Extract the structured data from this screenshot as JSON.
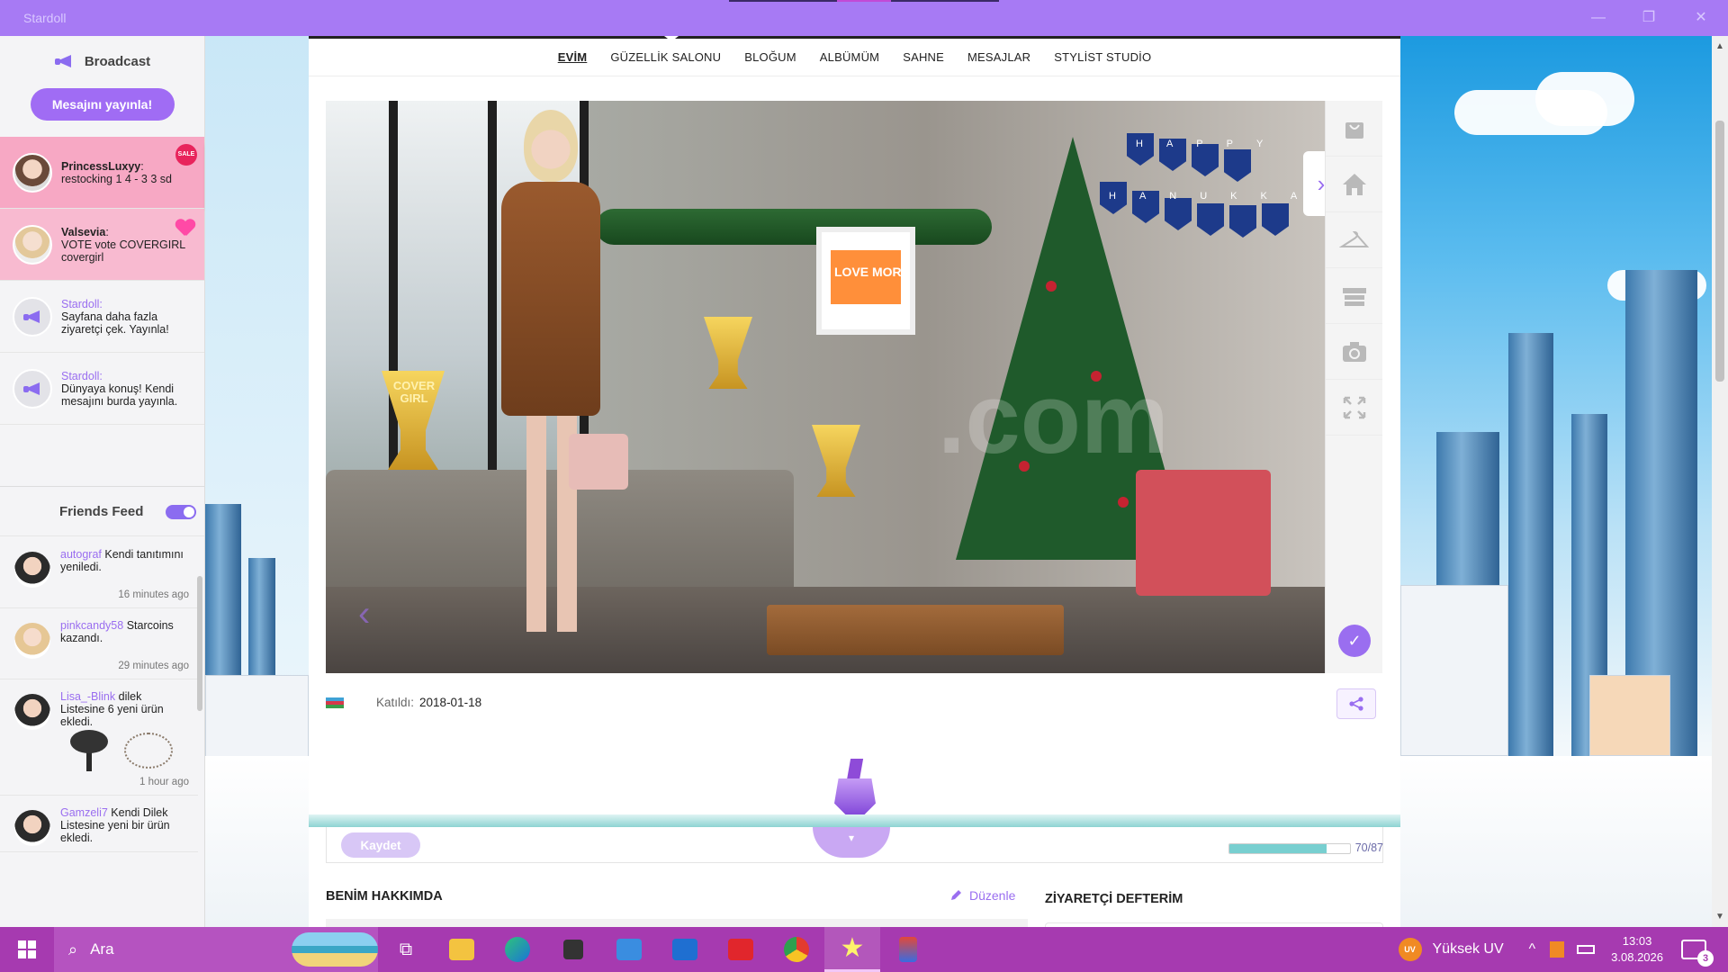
{
  "window": {
    "title": "Stardoll",
    "minimize_icon": "—",
    "restore_icon": "❐",
    "close_icon": "✕"
  },
  "sidebar": {
    "broadcast_title": "Broadcast",
    "publish_button": "Mesajını yayınla!",
    "collapse_icon": "‹",
    "broadcasts": [
      {
        "user": "PrincessLuxyy",
        "sep": ":",
        "message": "restocking 1 4 - 3 3 sd",
        "badge": "SALE"
      },
      {
        "user": "Valsevia",
        "sep": ":",
        "message": "VOTE vote COVERGIRL covergirl"
      },
      {
        "user": "Stardoll",
        "sep": ":",
        "message": "Sayfana daha fazla ziyaretçi çek. Yayınla!"
      },
      {
        "user": "Stardoll",
        "sep": ":",
        "message": "Dünyaya konuş! Kendi mesajını burda yayınla."
      }
    ],
    "friends_feed_title": "Friends Feed",
    "feed": [
      {
        "user": "autograf",
        "text": "Kendi tanıtımını yeniledi.",
        "time": "16 minutes ago"
      },
      {
        "user": "pinkcandy58",
        "text": "Starcoins kazandı.",
        "time": "29 minutes ago"
      },
      {
        "user": "Lisa_-Blink",
        "text": "dilek Listesine 6 yeni ürün ekledi.",
        "time": "1 hour ago"
      },
      {
        "user": "Gamzeli7",
        "text": "Kendi Dilek Listesine yeni bir ürün ekledi.",
        "time": ""
      }
    ]
  },
  "nav": {
    "tabs": [
      "EVİM",
      "GÜZELLİK SALONU",
      "BLOĞUM",
      "ALBÜMÜM",
      "SAHNE",
      "MESAJLAR",
      "STYLİST STUDİO"
    ],
    "active_index": 0
  },
  "room": {
    "trophy_text": "COVER GIRL",
    "poster_text": "LOVE MORE",
    "banner_text_1": "HAPPY",
    "banner_text_2": "HANUKKAH",
    "watermark": ".com",
    "next_icon": "›",
    "prev_icon": "‹",
    "confirm_icon": "✓"
  },
  "profile": {
    "joined_label": "Katıldı:",
    "joined_date": "2018-01-18",
    "flag": "Azerbaijan"
  },
  "save": {
    "save_button": "Kaydet",
    "progress_fraction": 0.8046,
    "progress_label": "70/87",
    "drop_icon": "▾"
  },
  "about": {
    "title": "BENİM HAKKIMDA",
    "edit_link": "Düzenle"
  },
  "visitors": {
    "title": "ZİYARETÇİ DEFTERİM"
  },
  "taskbar": {
    "search_placeholder": "Ara",
    "weather": "Yüksek UV",
    "uv_badge": "UV",
    "time": "13:03",
    "date": "3.08.2026",
    "notification_count": "3",
    "tray_chevron": "^"
  },
  "colors": {
    "accent": "#a06cf4",
    "titlebar": "#a77af4",
    "taskbar": "#a63ab0",
    "broadcast_pink": "#f7a8c4",
    "link": "#9a6ef0"
  }
}
